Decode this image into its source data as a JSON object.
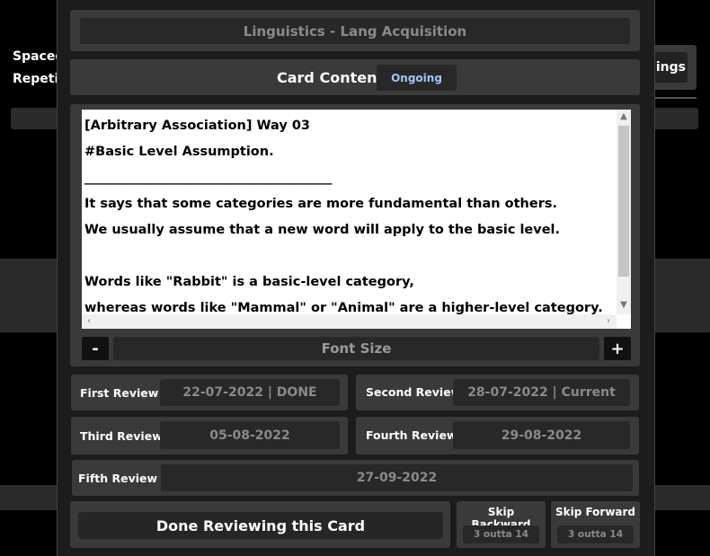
{
  "background": {
    "label_line1": "Spaced",
    "label_line2": "Repetit",
    "settings_fragment": "ings"
  },
  "modal": {
    "deck_title": "Linguistics - Lang Acquisition",
    "card_content_label": "Card Content",
    "status_badge": "Ongoing",
    "card_lines": [
      "[Arbitrary Association] Way 03",
      "#Basic Level Assumption.",
      "______________________________________",
      "It says that some categories are more fundamental than others.",
      "We usually assume that a new word will apply to the basic level.",
      "",
      "Words like \"Rabbit\" is a basic-level category,",
      "whereas words like \"Mammal\" or \"Animal\" are a higher-level category."
    ],
    "font_size": {
      "decrease": "-",
      "label": "Font Size",
      "increase": "+"
    },
    "reviews": {
      "first": {
        "label": "First Review",
        "value": "22-07-2022 | DONE"
      },
      "second": {
        "label": "Second Review",
        "value": "28-07-2022 | Current"
      },
      "third": {
        "label": "Third Review",
        "value": "05-08-2022"
      },
      "fourth": {
        "label": "Fourth Review",
        "value": "29-08-2022"
      },
      "fifth": {
        "label": "Fifth Review",
        "value": "27-09-2022"
      }
    },
    "done_button": "Done Reviewing this Card",
    "skip_backward": {
      "label": "Skip Backward",
      "count": "3 outta 14"
    },
    "skip_forward": {
      "label": "Skip Forward",
      "count": "3 outta 14"
    }
  },
  "colors": {
    "badge_text": "#9fc7f5",
    "panel": "#3a3a3a",
    "inner": "#282828"
  }
}
